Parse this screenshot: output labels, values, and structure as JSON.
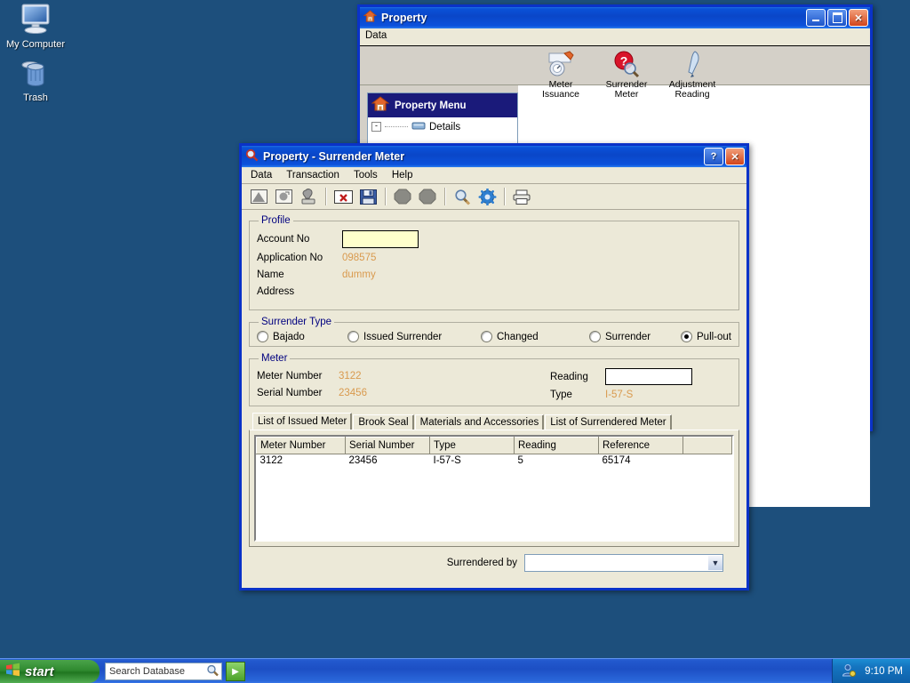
{
  "desktop": {
    "background_color": "#1d4f7c",
    "icons": [
      {
        "label": "My Computer",
        "icon": "my-computer-icon"
      },
      {
        "label": "Trash",
        "icon": "trash-icon"
      }
    ]
  },
  "property_window": {
    "title": "Property",
    "icon": "house-icon",
    "menu": {
      "data": "Data"
    },
    "buttons": {
      "minimize": "_",
      "maximize": "□",
      "close": "✕"
    },
    "menu_panel": {
      "header": "Property Menu",
      "header_icon": "house-icon",
      "tree_items": [
        {
          "expander": "-",
          "icon": "folder-icon",
          "label": "Details"
        }
      ]
    },
    "toolbar_icons": [
      {
        "label_line1": "Meter",
        "label_line2": "Issuance",
        "icon": "meter-issuance-icon"
      },
      {
        "label_line1": "Surrender",
        "label_line2": "Meter",
        "icon": "surrender-meter-icon"
      },
      {
        "label_line1": "Adjustment",
        "label_line2": "Reading",
        "icon": "adjustment-reading-icon"
      }
    ]
  },
  "dialog": {
    "title": "Property - Surrender Meter",
    "icon": "magnifier-red-icon",
    "buttons": {
      "help": "?",
      "close": "✕"
    },
    "menu_items": [
      "Data",
      "Transaction",
      "Tools",
      "Help"
    ],
    "toolbar": [
      {
        "name": "new-icon",
        "enabled": false
      },
      {
        "name": "edit-icon",
        "enabled": false
      },
      {
        "name": "stamp-icon",
        "enabled": false
      },
      {
        "name": "delete-icon",
        "enabled": true
      },
      {
        "name": "save-icon",
        "enabled": true
      },
      {
        "name": "octagon-stop-icon",
        "enabled": false
      },
      {
        "name": "octagon-stop2-icon",
        "enabled": false
      },
      {
        "name": "search-icon",
        "enabled": true
      },
      {
        "name": "settings-gear-icon",
        "enabled": true
      },
      {
        "name": "print-icon",
        "enabled": true
      }
    ],
    "profile": {
      "legend": "Profile",
      "account_no_label": "Account No",
      "account_no_value": "",
      "application_no_label": "Application No",
      "application_no_value": "098575",
      "name_label": "Name",
      "name_value": "dummy",
      "address_label": "Address",
      "address_value": ""
    },
    "surrender_type": {
      "legend": "Surrender Type",
      "options": [
        {
          "label": "Bajado",
          "selected": false
        },
        {
          "label": "Issued Surrender",
          "selected": false
        },
        {
          "label": "Changed",
          "selected": false
        },
        {
          "label": "Surrender",
          "selected": false
        },
        {
          "label": "Pull-out",
          "selected": true
        }
      ]
    },
    "meter": {
      "legend": "Meter",
      "meter_number_label": "Meter Number",
      "meter_number_value": "3122",
      "serial_number_label": "Serial Number",
      "serial_number_value": "23456",
      "reading_label": "Reading",
      "reading_value": "",
      "type_label": "Type",
      "type_value": "I-57-S"
    },
    "tabs": [
      {
        "label": "List of Issued Meter",
        "selected": true
      },
      {
        "label": "Brook Seal",
        "selected": false
      },
      {
        "label": "Materials and Accessories",
        "selected": false
      },
      {
        "label": "List of Surrendered Meter",
        "selected": false
      }
    ],
    "grid": {
      "columns": [
        "Meter Number",
        "Serial Number",
        "Type",
        "Reading",
        "Reference",
        ""
      ],
      "rows": [
        [
          "3122",
          "23456",
          "I-57-S",
          "5",
          "65174",
          ""
        ]
      ]
    },
    "footer": {
      "surrendered_by_label": "Surrendered by",
      "surrendered_by_value": ""
    },
    "accent_value_color": "#d99a4e",
    "legend_color": "#00007f"
  },
  "taskbar": {
    "start_label": "start",
    "search_placeholder": "Search Database",
    "search_value": "",
    "search_icon": "magnifier-icon",
    "go_label": "▶",
    "tray_icon": "user-account-icon",
    "clock": "9:10 PM"
  }
}
